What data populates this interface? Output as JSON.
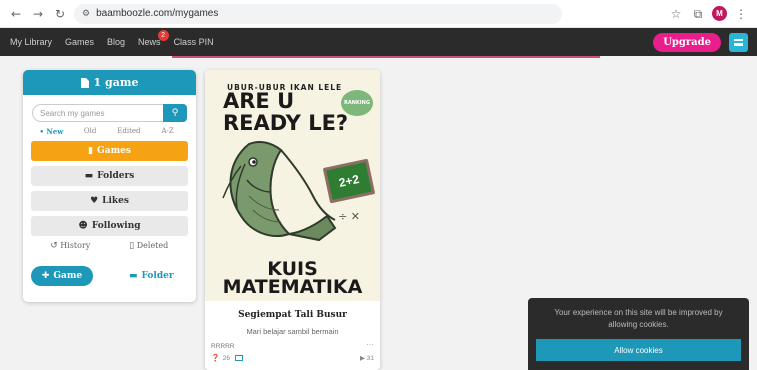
{
  "browser": {
    "url": "baamboozle.com/mygames",
    "profile_initial": "M"
  },
  "nav": {
    "items": [
      "My Library",
      "Games",
      "Blog",
      "News",
      "Class PIN"
    ],
    "news_badge": "2",
    "upgrade_label": "Upgrade"
  },
  "library": {
    "header": "1 game",
    "search_placeholder": "Search my games",
    "sorts": [
      "• New",
      "Old",
      "Edited",
      "A-Z"
    ],
    "nav_items": [
      {
        "label": "Games",
        "active": true
      },
      {
        "label": "Folders",
        "active": false
      },
      {
        "label": "Likes",
        "active": false
      },
      {
        "label": "Following",
        "active": false
      }
    ],
    "history_label": "History",
    "deleted_label": "Deleted",
    "add_game_label": "Game",
    "add_folder_label": "Folder"
  },
  "game_card": {
    "cover": {
      "line1": "UBUR-UBUR IKAN LELE",
      "line2": "ARE U",
      "line3": "READY LE?",
      "stamp": "RANKING",
      "board": "2+2",
      "bottom1": "KUIS",
      "bottom2": "MATEMATIKA"
    },
    "title": "Segiempat Tali Busur",
    "description": "Mari belajar sambil bermain",
    "author": "RRRRR",
    "question_count": "26",
    "plays": "31"
  },
  "cookie": {
    "message": "Your experience on this site will be improved by allowing cookies.",
    "button": "Allow cookies"
  },
  "colors": {
    "accent": "#1e98b8",
    "active_nav": "#f5a312",
    "upgrade": "#e91e8c",
    "dark_bar": "#2b2b2b"
  }
}
